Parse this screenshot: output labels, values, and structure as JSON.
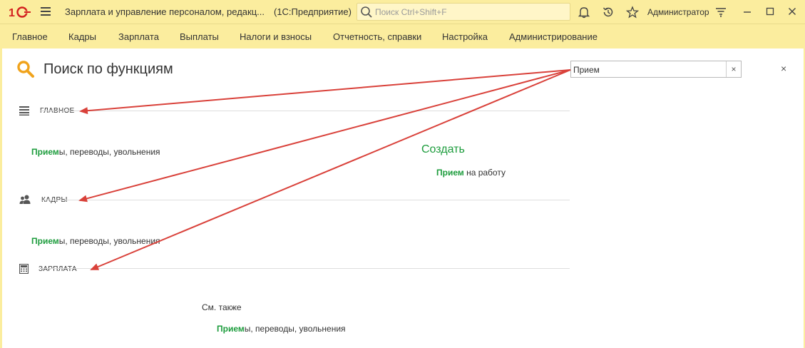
{
  "window": {
    "title": "Зарплата и управление персоналом, редакц...",
    "app_name": "(1С:Предприятие)",
    "search_placeholder": "Поиск Ctrl+Shift+F",
    "user": "Администратор"
  },
  "menu": {
    "items": [
      {
        "label": "Главное"
      },
      {
        "label": "Кадры"
      },
      {
        "label": "Зарплата"
      },
      {
        "label": "Выплаты"
      },
      {
        "label": "Налоги и взносы"
      },
      {
        "label": "Отчетность, справки"
      },
      {
        "label": "Настройка"
      },
      {
        "label": "Администрирование"
      }
    ]
  },
  "page": {
    "title": "Поиск по функциям",
    "search_value": "Прием",
    "clear_label": "×",
    "close_label": "×"
  },
  "sections": [
    {
      "label": "ГЛАВНОЕ",
      "icon": "list-icon",
      "results": [
        {
          "highlight": "Прием",
          "rest": "ы, переводы, увольнения"
        }
      ]
    },
    {
      "label": "КАДРЫ",
      "icon": "users-icon",
      "results": [
        {
          "highlight": "Прием",
          "rest": "ы, переводы, увольнения"
        }
      ]
    },
    {
      "label": "ЗАРПЛАТА",
      "icon": "calculator-icon",
      "results": []
    }
  ],
  "create": {
    "title": "Создать",
    "items": [
      {
        "highlight": "Прием",
        "rest": " на работу"
      }
    ]
  },
  "see_also": {
    "title": "См. также",
    "items": [
      {
        "highlight": "Прием",
        "rest": "ы, переводы, увольнения"
      }
    ]
  },
  "colors": {
    "titlebar_bg": "#fbed9e",
    "highlight": "#1c9c3c",
    "arrow": "#d9413a"
  }
}
